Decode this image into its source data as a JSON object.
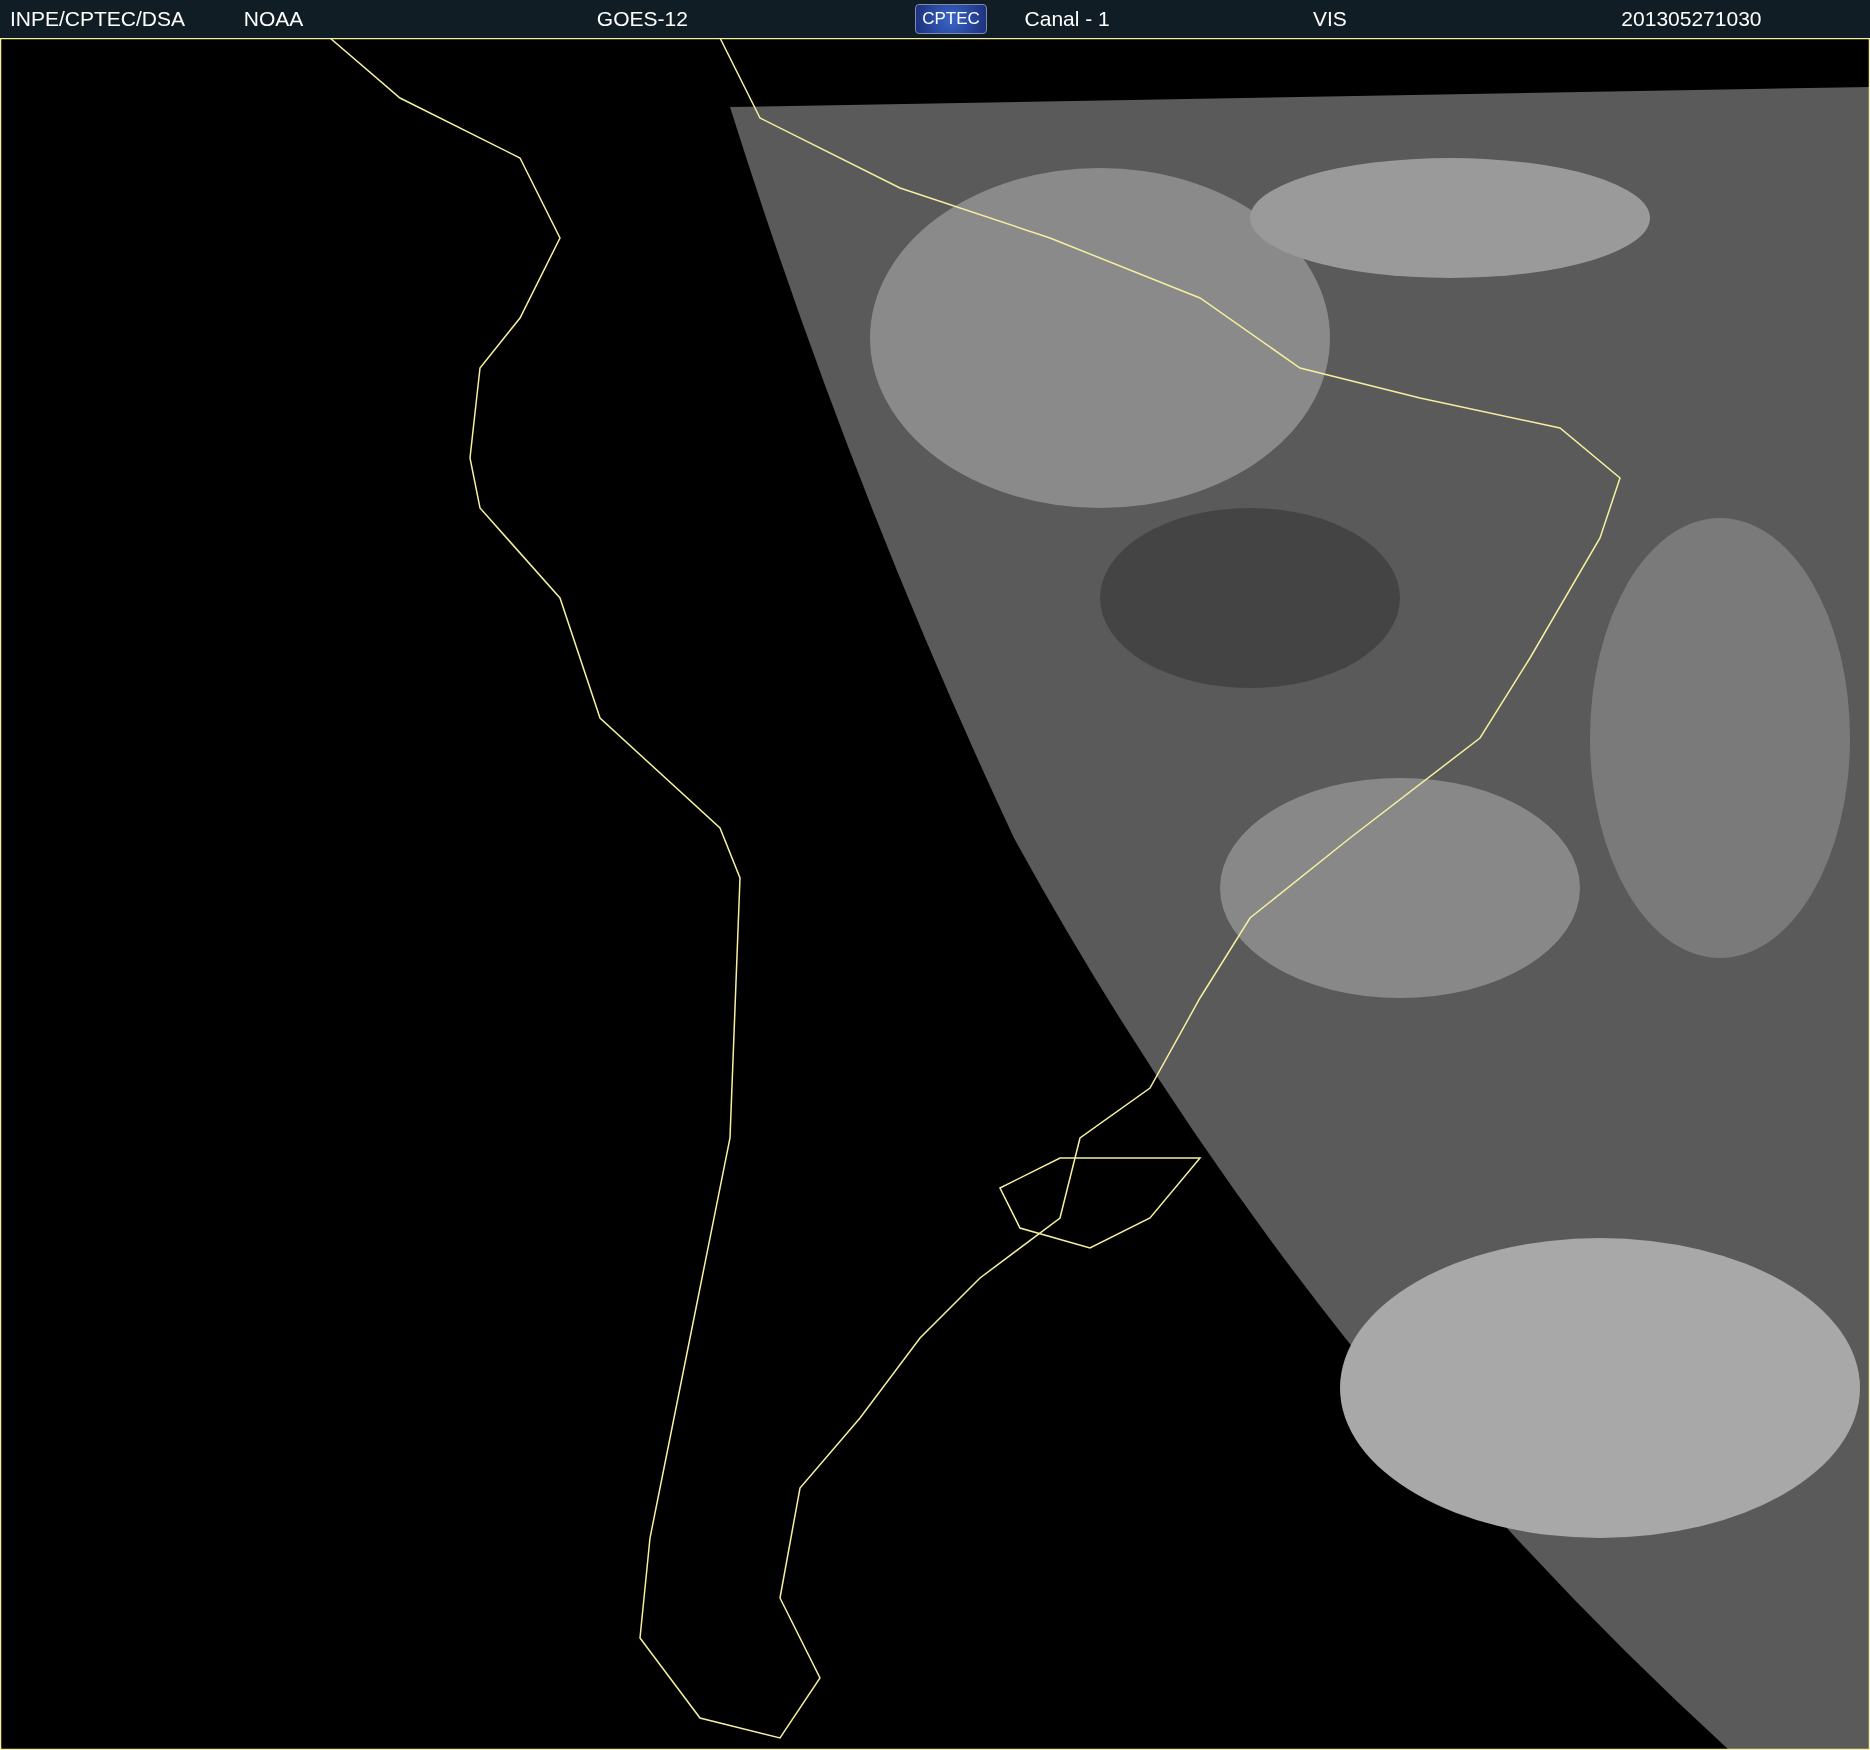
{
  "header": {
    "items": [
      {
        "kind": "text",
        "label": "INPE/CPTEC/DSA"
      },
      {
        "kind": "text",
        "label": "NOAA"
      },
      {
        "kind": "text",
        "label": "GOES-12"
      },
      {
        "kind": "logo",
        "label": "CPTEC"
      },
      {
        "kind": "text",
        "label": "Canal - 1"
      },
      {
        "kind": "text",
        "label": "VIS"
      },
      {
        "kind": "text",
        "label": "201305271030"
      }
    ]
  }
}
